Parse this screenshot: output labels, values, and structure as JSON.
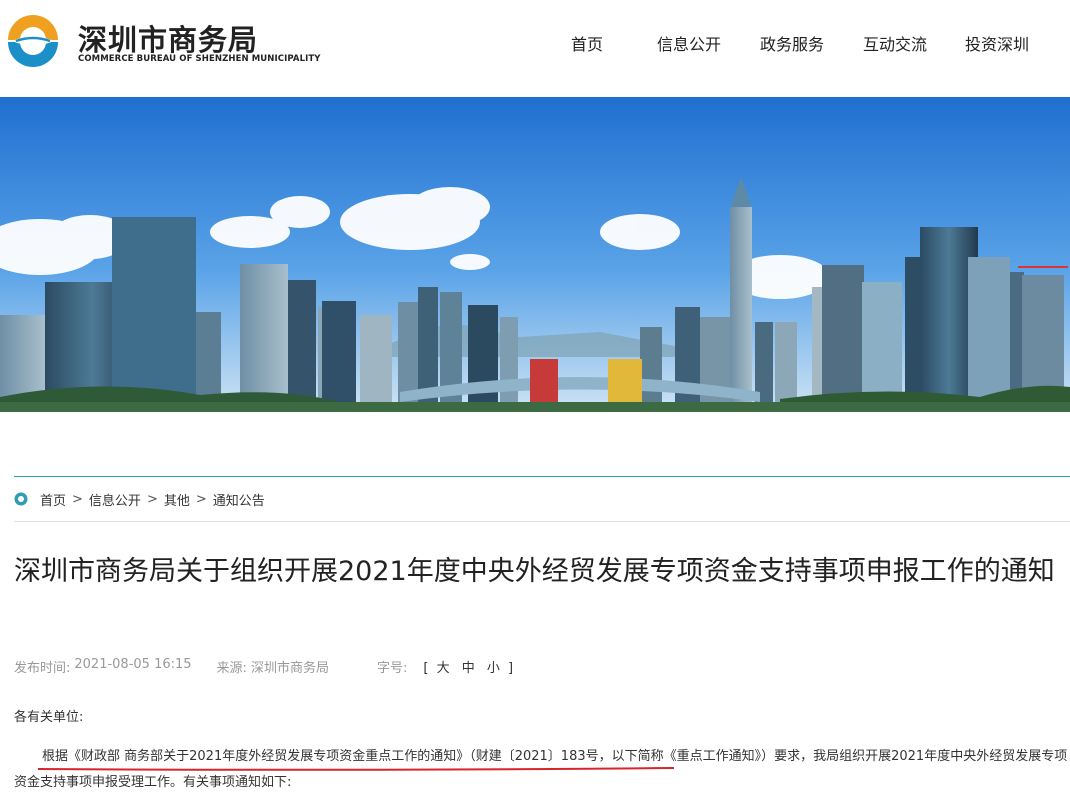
{
  "header": {
    "logo_cn": "深圳市商务局",
    "logo_en": "COMMERCE BUREAU OF SHENZHEN MUNICIPALITY",
    "nav": [
      "首页",
      "信息公开",
      "政务服务",
      "互动交流",
      "投资深圳"
    ]
  },
  "breadcrumb": {
    "items": [
      "首页",
      "信息公开",
      "其他",
      "通知公告"
    ],
    "separator": ">"
  },
  "article": {
    "title": "深圳市商务局关于组织开展2021年度中央外经贸发展专项资金支持事项申报工作的通知",
    "meta": {
      "publish_label": "发布时间:",
      "publish_value": "2021-08-05 16:15",
      "source_label": "来源:",
      "source_value": "深圳市商务局",
      "fontsize_label": "字号:",
      "fontsize_open": "[",
      "fontsize_large": "大",
      "fontsize_medium": "中",
      "fontsize_small": "小",
      "fontsize_close": "]"
    },
    "greeting": "各有关单位:",
    "paragraph": "根据《财政部 商务部关于2021年度外经贸发展专项资金重点工作的通知》（财建〔2021〕183号，以下简称《重点工作通知》）要求，我局组织开展2021年度中央外经贸发展专项资金支持事项申报受理工作。有关事项通知如下:"
  },
  "colors": {
    "accent": "#2e9cb3",
    "highlight_underline": "#d6262b",
    "logo_orange": "#f0a020",
    "logo_blue": "#1a8fc8"
  }
}
